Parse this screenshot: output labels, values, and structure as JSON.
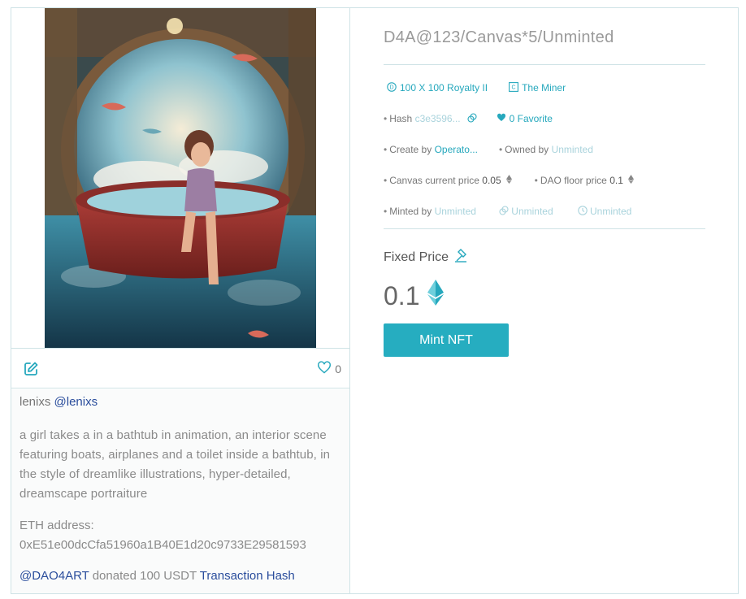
{
  "nft": {
    "title": "D4A@123/Canvas*5/Unminted",
    "tags": [
      {
        "icon": "d-circle-icon",
        "label": "100 X 100 Royalty II"
      },
      {
        "icon": "c-square-icon",
        "label": "The Miner"
      }
    ],
    "hash_label": "Hash",
    "hash_value": "c3e3596...",
    "favorite_label": "0 Favorite",
    "create_label": "Create by",
    "create_value": "Operato...",
    "owned_label": "Owned by",
    "owned_value": "Unminted",
    "canvas_price_label": "Canvas current price",
    "canvas_price_value": "0.05",
    "dao_floor_label": "DAO floor price",
    "dao_floor_value": "0.1",
    "minted_label": "Minted by",
    "minted_value": "Unminted",
    "link_value": "Unminted",
    "time_value": "Unminted",
    "fixed_price_label": "Fixed Price",
    "price": "0.1",
    "mint_button": "Mint NFT"
  },
  "left": {
    "like_count": "0",
    "author_name": "lenixs",
    "author_handle": "@lenixs",
    "description": "a girl takes a in a bathtub in animation, an interior scene featuring boats, airplanes and a toilet inside a bathtub, in the style of dreamlike illustrations, hyper-detailed, dreamscape portraiture",
    "eth_label": "ETH address:",
    "eth_address": "0xE51e00dcCfa51960a1B40E1d20c9733E29581593",
    "donor": "@DAO4ART",
    "donate_text": "donated 100 USDT",
    "tx_link": "Transaction Hash"
  },
  "colors": {
    "accent": "#26adc0",
    "link": "#2a4d9c",
    "muted_teal": "#a9d3dc",
    "border": "#cfe3e6"
  }
}
